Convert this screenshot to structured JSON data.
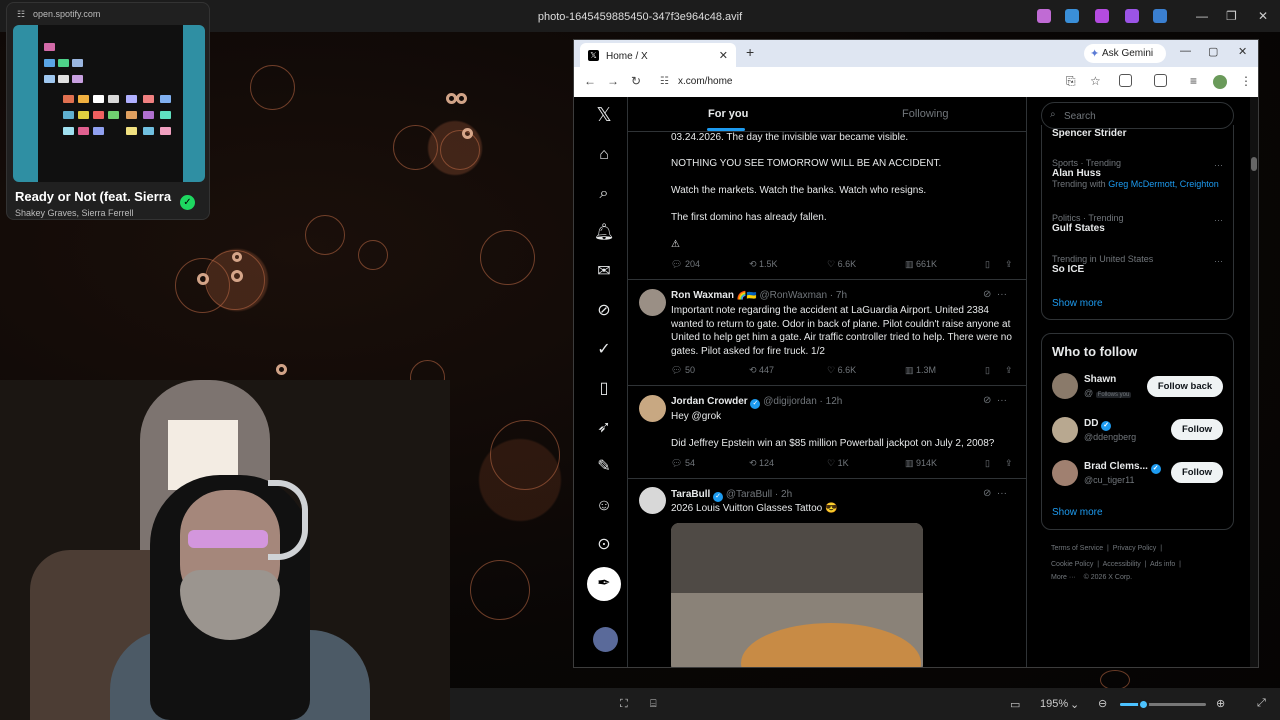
{
  "viewer": {
    "title": "photo-1645459885450-347f3e964c48.avif",
    "zoom": "195%",
    "zoom_fraction": 0.27
  },
  "spotify": {
    "url": "open.spotify.com",
    "song": "Ready or Not (feat. Sierra",
    "artist": "Shakey Graves, Sierra Ferrell"
  },
  "browser": {
    "tab_title": "Home / X",
    "new_tab": "+",
    "gemini": "Ask Gemini",
    "url": "x.com/home"
  },
  "x": {
    "tabs": {
      "for_you": "For you",
      "following": "Following"
    },
    "post1": {
      "line1": "03.24.2026. The day the invisible war became visible.",
      "line2": "NOTHING YOU SEE TOMORROW WILL BE AN ACCIDENT.",
      "line3": "Watch the markets. Watch the banks. Watch who resigns.",
      "line4": "The first domino has already fallen.",
      "line5": "⚠",
      "replies": "204",
      "reposts": "1.5K",
      "likes": "6.6K",
      "views": "661K"
    },
    "post2": {
      "name": "Ron Waxman",
      "handle": "@RonWaxman · 7h",
      "text": "Important note regarding the accident at LaGuardia Airport.  United 2384 wanted to return to gate.  Odor in back of plane.  Pilot couldn't raise anyone at United to help get him a gate.  Air traffic controller tried to help.  There were no gates.  Pilot asked for fire truck. 1/2",
      "replies": "50",
      "reposts": "447",
      "likes": "6.6K",
      "views": "1.3M"
    },
    "post3": {
      "name": "Jordan Crowder",
      "handle": "@digijordan · 12h",
      "mention": "Hey @grok",
      "text": "Did Jeffrey Epstein win an $85 million Powerball jackpot on July 2, 2008?",
      "replies": "54",
      "reposts": "124",
      "likes": "1K",
      "views": "914K"
    },
    "post4": {
      "name": "TaraBull",
      "handle": "@TaraBull · 2h",
      "text": "2026 Louis Vuitton Glasses Tattoo 😎"
    },
    "search_placeholder": "Search",
    "trends": [
      {
        "category": "",
        "name": "Spencer Strider",
        "extra": ""
      },
      {
        "category": "Sports · Trending",
        "name": "Alan Huss",
        "extra": "Trending with",
        "link": "Greg McDermott, Creighton"
      },
      {
        "category": "Politics · Trending",
        "name": "Gulf States",
        "extra": ""
      },
      {
        "category": "Trending in United States",
        "name": "So ICE",
        "extra": ""
      }
    ],
    "show_more": "Show more",
    "who_to_follow": "Who to follow",
    "follow": [
      {
        "name": "Shawn",
        "handle": "@",
        "badge": "Follows you",
        "button": "Follow back"
      },
      {
        "name": "DD",
        "handle": "@ddengberg",
        "button": "Follow"
      },
      {
        "name": "Brad Clems...",
        "handle": "@cu_tiger11",
        "button": "Follow"
      }
    ],
    "footer": {
      "tos": "Terms of Service",
      "privacy": "Privacy Policy",
      "cookie": "Cookie Policy",
      "access": "Accessibility",
      "ads": "Ads info",
      "more": "More ···",
      "copy": "© 2026 X Corp."
    }
  },
  "colors": {
    "accent": "#1d9bf0",
    "spotify_green": "#1ed760",
    "viewer_accent": "#4cc2ff"
  }
}
